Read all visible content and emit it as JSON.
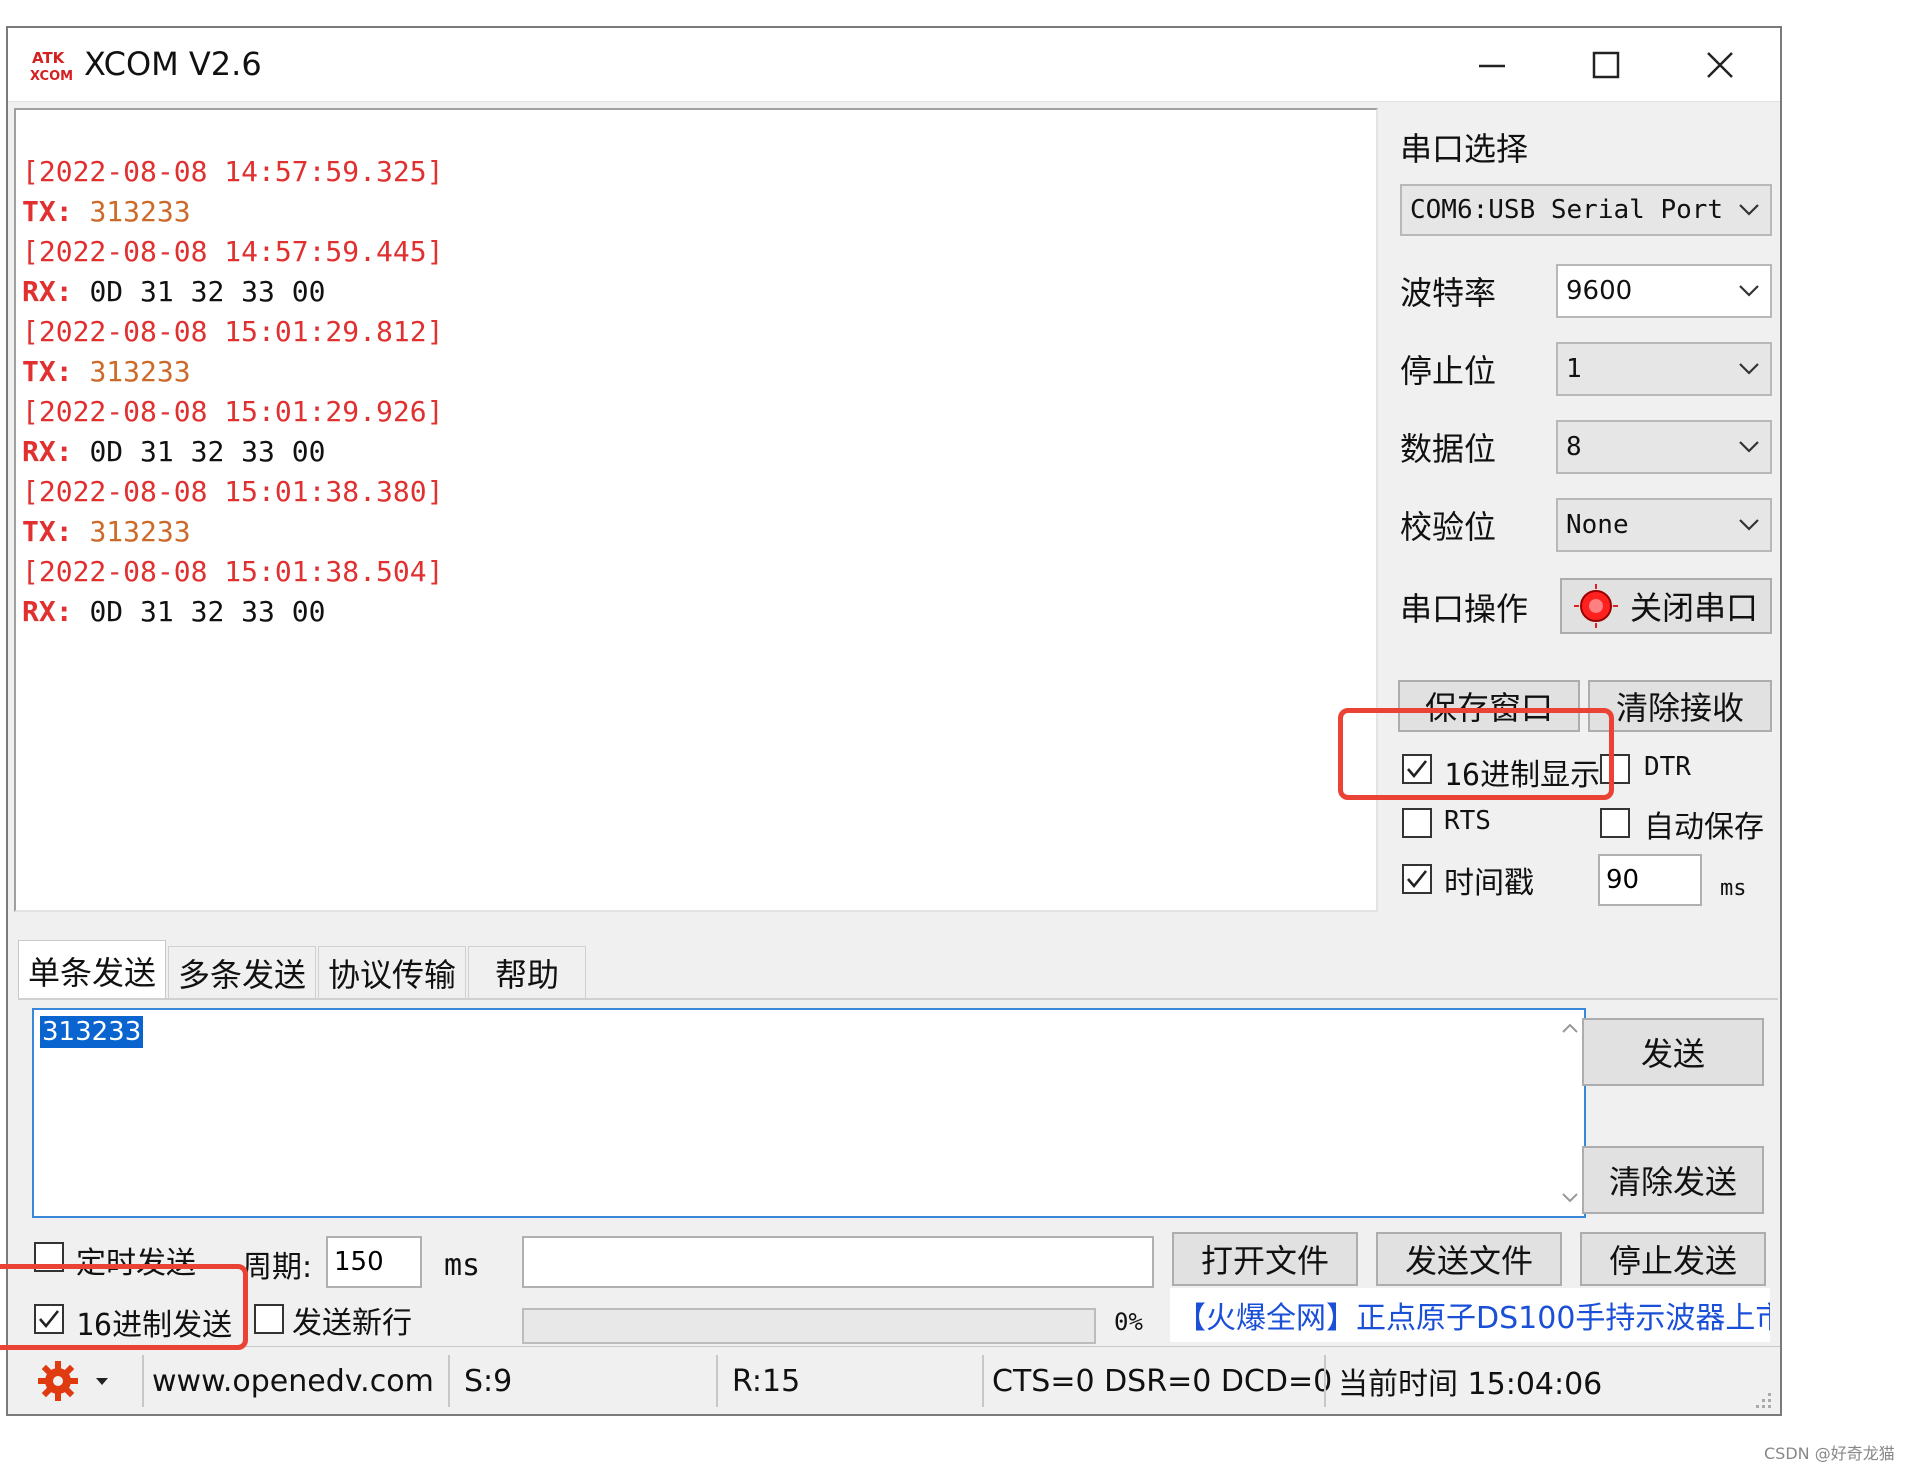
{
  "window": {
    "title": "XCOM V2.6",
    "logo_text": "ATK XCOM"
  },
  "receive_log": [
    {
      "kind": "ts",
      "text": "[2022-08-08 14:57:59.325]"
    },
    {
      "kind": "tx",
      "label": "TX:",
      "value": "313233"
    },
    {
      "kind": "ts",
      "text": "[2022-08-08 14:57:59.445]"
    },
    {
      "kind": "rx",
      "label": "RX:",
      "value": "0D 31 32 33 00"
    },
    {
      "kind": "ts",
      "text": "[2022-08-08 15:01:29.812]"
    },
    {
      "kind": "tx",
      "label": "TX:",
      "value": "313233"
    },
    {
      "kind": "ts",
      "text": "[2022-08-08 15:01:29.926]"
    },
    {
      "kind": "rx",
      "label": "RX:",
      "value": "0D 31 32 33 00"
    },
    {
      "kind": "ts",
      "text": "[2022-08-08 15:01:38.380]"
    },
    {
      "kind": "tx",
      "label": "TX:",
      "value": "313233"
    },
    {
      "kind": "ts",
      "text": "[2022-08-08 15:01:38.504]"
    },
    {
      "kind": "rx",
      "label": "RX:",
      "value": "0D 31 32 33 00"
    }
  ],
  "settings": {
    "port_select_label": "串口选择",
    "port_value": "COM6:USB Serial Port",
    "baud_label": "波特率",
    "baud_value": "9600",
    "stopbits_label": "停止位",
    "stopbits_value": "1",
    "databits_label": "数据位",
    "databits_value": "8",
    "parity_label": "校验位",
    "parity_value": "None",
    "port_op_label": "串口操作",
    "close_port_button": "关闭串口",
    "save_window_button": "保存窗口",
    "clear_receive_button": "清除接收",
    "hex_display_label": "16进制显示",
    "hex_display_checked": true,
    "dtr_label": "DTR",
    "dtr_checked": false,
    "rts_label": "RTS",
    "rts_checked": false,
    "autosave_label": "自动保存",
    "autosave_checked": false,
    "timestamp_label": "时间戳",
    "timestamp_checked": true,
    "timestamp_interval": "90",
    "timestamp_unit": "ms"
  },
  "tabs": [
    "单条发送",
    "多条发送",
    "协议传输",
    "帮助"
  ],
  "send": {
    "text": "313233",
    "send_button": "发送",
    "clear_send_button": "清除发送",
    "timed_send_label": "定时发送",
    "timed_send_checked": false,
    "period_label": "周期:",
    "period_value": "150",
    "period_unit": "ms",
    "open_file_button": "打开文件",
    "send_file_button": "发送文件",
    "stop_send_button": "停止发送",
    "hex_send_label": "16进制发送",
    "hex_send_checked": true,
    "newline_label": "发送新行",
    "newline_checked": false,
    "progress_text": "0%",
    "progress_fraction": 0,
    "ad_text": "【火爆全网】正点原子DS100手持示波器上市"
  },
  "statusbar": {
    "website": "www.openedv.com",
    "sent": "S:9",
    "received": "R:15",
    "signals": "CTS=0 DSR=0 DCD=0",
    "current_time": "当前时间 15:04:06"
  },
  "colors": {
    "highlight_box": "#ea4336",
    "accent": "#0a64d0",
    "log_red": "#e03030",
    "log_orange": "#cc6a2a"
  },
  "watermark": "CSDN @好奇龙猫"
}
